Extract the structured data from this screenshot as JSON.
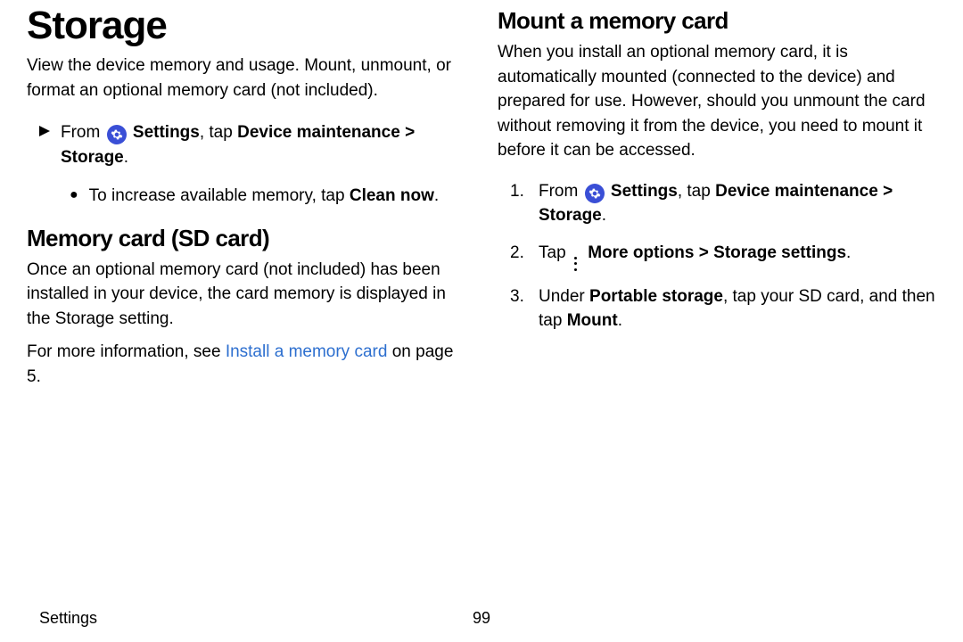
{
  "left": {
    "title": "Storage",
    "intro": "View the device memory and usage. Mount, unmount, or format an optional memory card (not included).",
    "path_pre": "From ",
    "path_settings": "Settings",
    "path_mid": ", tap ",
    "path_dm": "Device maintenance",
    "path_chev": " > ",
    "path_storage": "Storage",
    "path_period": ".",
    "bullet_pre": "To increase available memory, tap ",
    "bullet_bold": "Clean now",
    "bullet_post": ".",
    "sd_title": "Memory card (SD card)",
    "sd_body": "Once an optional memory card (not included) has been installed in your device, the card memory is displayed in the Storage setting.",
    "sd_more_pre": "For more information, see ",
    "sd_more_link": "Install a memory card",
    "sd_more_post": " on page 5."
  },
  "right": {
    "title": "Mount a memory card",
    "intro": "When you install an optional memory card, it is automatically mounted (connected to the device) and prepared for use. However, should you unmount the card without removing it from the device, you need to mount it before it can be accessed.",
    "step1_pre": "From ",
    "step1_settings": "Settings",
    "step1_mid": ", tap ",
    "step1_dm": "Device maintenance",
    "step1_chev": " > ",
    "step1_storage": "Storage",
    "step1_post": ".",
    "step2_pre": "Tap ",
    "step2_more": "More options",
    "step2_chev": " > ",
    "step2_ss": "Storage settings",
    "step2_post": ".",
    "step3_pre": "Under ",
    "step3_ps": "Portable storage",
    "step3_mid": ", tap your SD card, and then tap ",
    "step3_mount": "Mount",
    "step3_post": "."
  },
  "footer": {
    "section": "Settings",
    "page": "99"
  }
}
